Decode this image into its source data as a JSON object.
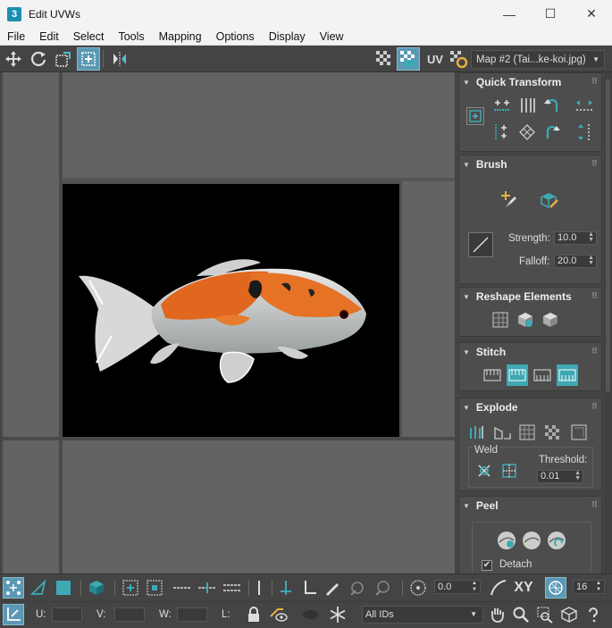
{
  "window": {
    "title": "Edit UVWs",
    "app_icon": "3",
    "minimize": "—",
    "maximize": "☐",
    "close": "✕"
  },
  "menu": [
    "File",
    "Edit",
    "Select",
    "Tools",
    "Mapping",
    "Options",
    "Display",
    "View"
  ],
  "toolbar": {
    "uv_label": "UV",
    "map_select": "Map #2 (Tai...ke-koi.jpg)"
  },
  "panel": {
    "quick_transform": {
      "title": "Quick Transform"
    },
    "brush": {
      "title": "Brush",
      "strength_label": "Strength:",
      "strength": "10.0",
      "falloff_label": "Falloff:",
      "falloff": "20.0"
    },
    "reshape": {
      "title": "Reshape Elements"
    },
    "stitch": {
      "title": "Stitch"
    },
    "explode": {
      "title": "Explode",
      "weld_label": "Weld",
      "threshold_label": "Threshold:",
      "threshold": "0.01"
    },
    "peel": {
      "title": "Peel",
      "detach_label": "Detach",
      "detach_checked": true
    }
  },
  "bottom": {
    "soft_select_value": "0.0",
    "xy_label": "XY",
    "grid_value": "16",
    "u_label": "U:",
    "v_label": "V:",
    "w_label": "W:",
    "l_label": "L:",
    "u_value": "",
    "v_value": "",
    "w_value": "",
    "ids_select": "All IDs"
  },
  "colors": {
    "accent": "#3ea9b3",
    "active": "#5b98b5",
    "bg": "#444444",
    "viewport": "#636363"
  }
}
